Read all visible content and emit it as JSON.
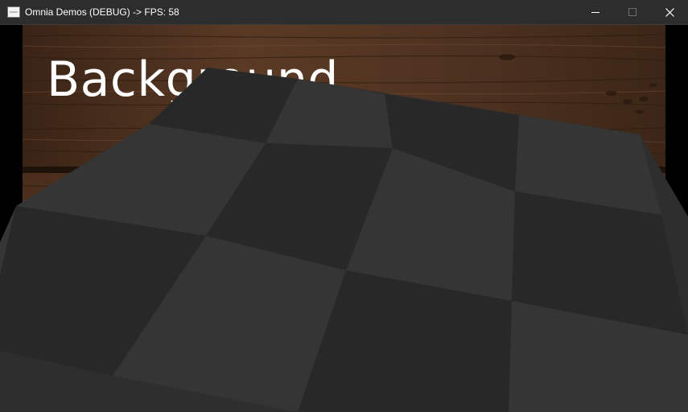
{
  "window": {
    "title": "Omnia Demos (DEBUG) -> FPS: 58",
    "app_icon": "omnia-app-icon",
    "controls": {
      "minimize_icon": "minimize-icon",
      "maximize_icon": "maximize-icon",
      "close_icon": "close-icon"
    }
  },
  "scene": {
    "background_label": "Background",
    "background_texture": "wood-planks",
    "floor_pattern": "checkerboard",
    "colors": {
      "floor_dark": "#2b2b2b",
      "floor_light": "#333333",
      "wood_base": "#4a2e1d"
    }
  }
}
